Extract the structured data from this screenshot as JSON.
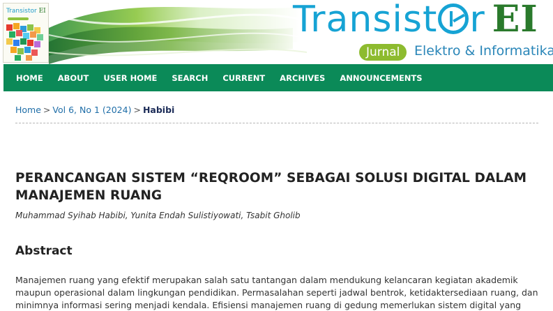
{
  "header": {
    "cover_title": "Transistor",
    "cover_title_ei": "EI",
    "brand_title_pre": "Transist",
    "brand_title_post": "r",
    "brand_title_ei": "EI",
    "jurnal_label": "Jurnal",
    "jurnal_sub": "Elektro & Informatika",
    "colors": {
      "brand_blue": "#16a3d4",
      "brand_green": "#8dbb2f",
      "nav_green": "#0b8a58"
    }
  },
  "nav": {
    "items": [
      "HOME",
      "ABOUT",
      "USER HOME",
      "SEARCH",
      "CURRENT",
      "ARCHIVES",
      "ANNOUNCEMENTS"
    ]
  },
  "breadcrumb": {
    "home": "Home",
    "issue": "Vol 6, No 1 (2024)",
    "current": "Habibi",
    "separator": ">"
  },
  "article": {
    "title": "PERANCANGAN SISTEM “REQROOM” SEBAGAI SOLUSI DIGITAL DALAM MANAJEMEN RUANG",
    "authors": "Muhammad Syihab Habibi, Yunita Endah Sulistiyowati, Tsabit Gholib",
    "abstract_heading": "Abstract",
    "abstract_text": "Manajemen ruang yang efektif merupakan salah satu tantangan dalam mendukung kelancaran kegiatan akademik maupun operasional dalam lingkungan pendidikan. Permasalahan seperti jadwal bentrok, ketidaktersediaan ruang, dan minimnya informasi sering menjadi kendala. Efisiensi manajemen ruang di gedung memerlukan sistem digital yang intuitif dan mudah"
  }
}
